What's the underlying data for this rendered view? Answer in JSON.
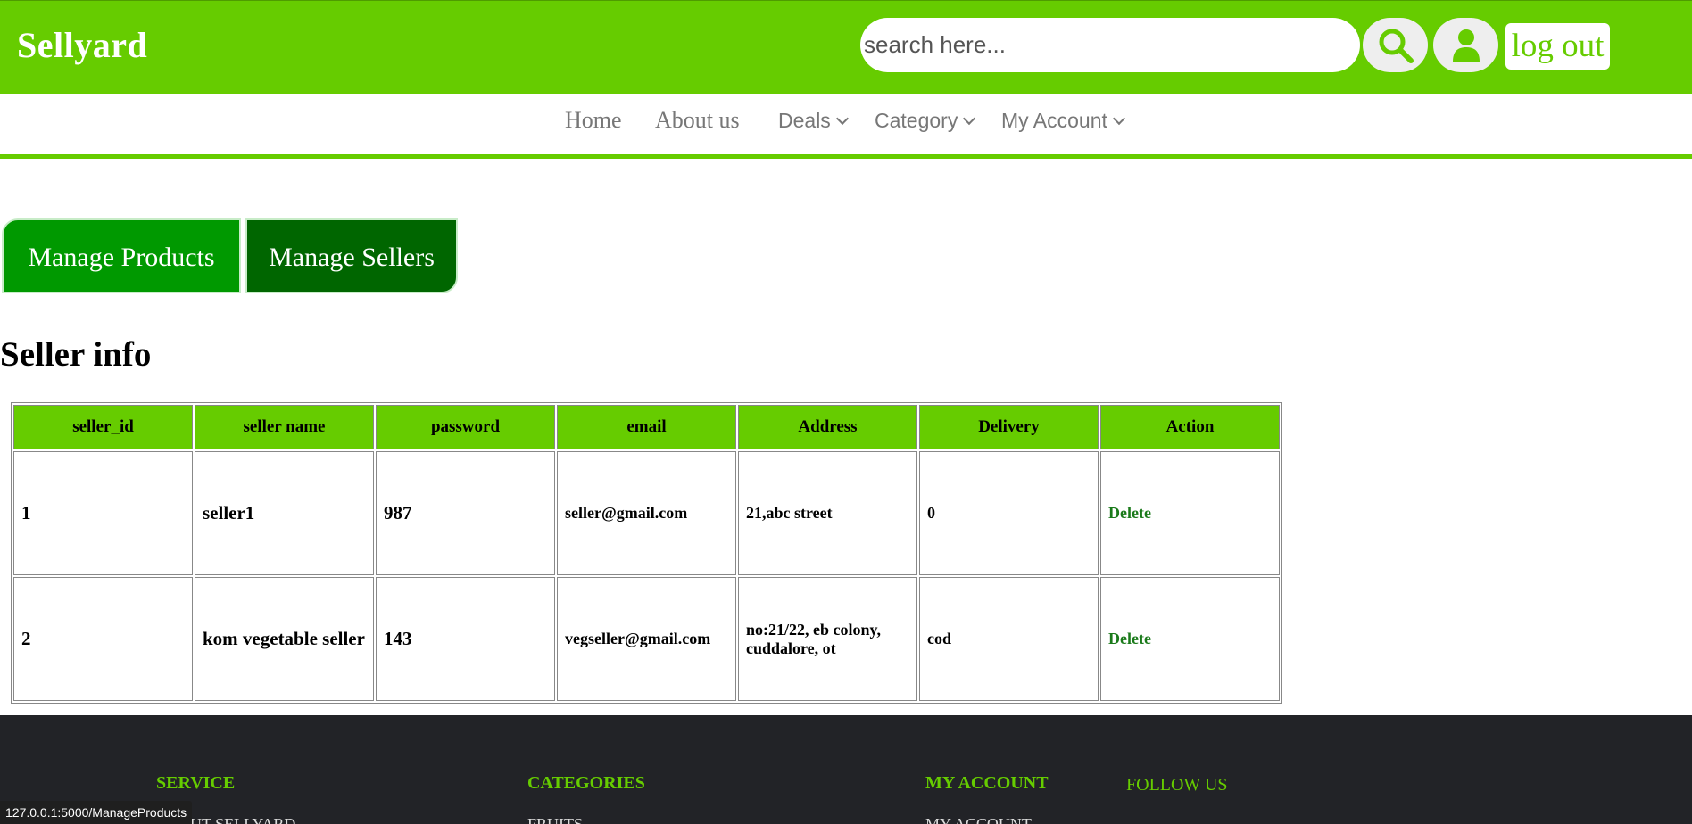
{
  "header": {
    "brand": "Sellyard",
    "search_placeholder": "search here...",
    "logout_label": "log out"
  },
  "nav": {
    "items": [
      {
        "label": "Home"
      },
      {
        "label": "About us"
      },
      {
        "label": "Deals"
      },
      {
        "label": "Category"
      },
      {
        "label": "My Account"
      }
    ]
  },
  "tabs": {
    "manage_products": "Manage Products",
    "manage_sellers": "Manage Sellers"
  },
  "page_title": "Seller info",
  "table": {
    "headers": [
      "seller_id",
      "seller name",
      "password",
      "email",
      "Address",
      "Delivery",
      "Action"
    ],
    "rows": [
      {
        "id": "1",
        "name": "seller1",
        "password": "987",
        "email": "seller@gmail.com",
        "address": "21,abc street",
        "delivery": "0",
        "action": "Delete"
      },
      {
        "id": "2",
        "name": "kom vegetable seller",
        "password": "143",
        "email": "vegseller@gmail.com",
        "address": "no:21/22, eb colony, cuddalore, ot",
        "delivery": "cod",
        "action": "Delete"
      }
    ]
  },
  "footer": {
    "service": "SERVICE",
    "service_link": "ABOUT SELLYARD",
    "categories": "CATEGORIES",
    "categories_link": "FRUITS",
    "my_account": "MY ACCOUNT",
    "my_account_link": "MY ACCOUNT",
    "follow_us": "FOLLOW US"
  },
  "status_bar": "127.0.0.1:5000/ManageProducts",
  "colors": {
    "brand_green": "#66cc00",
    "tab_products": "#009900",
    "tab_sellers": "#006600",
    "footer_bg": "#222327"
  }
}
